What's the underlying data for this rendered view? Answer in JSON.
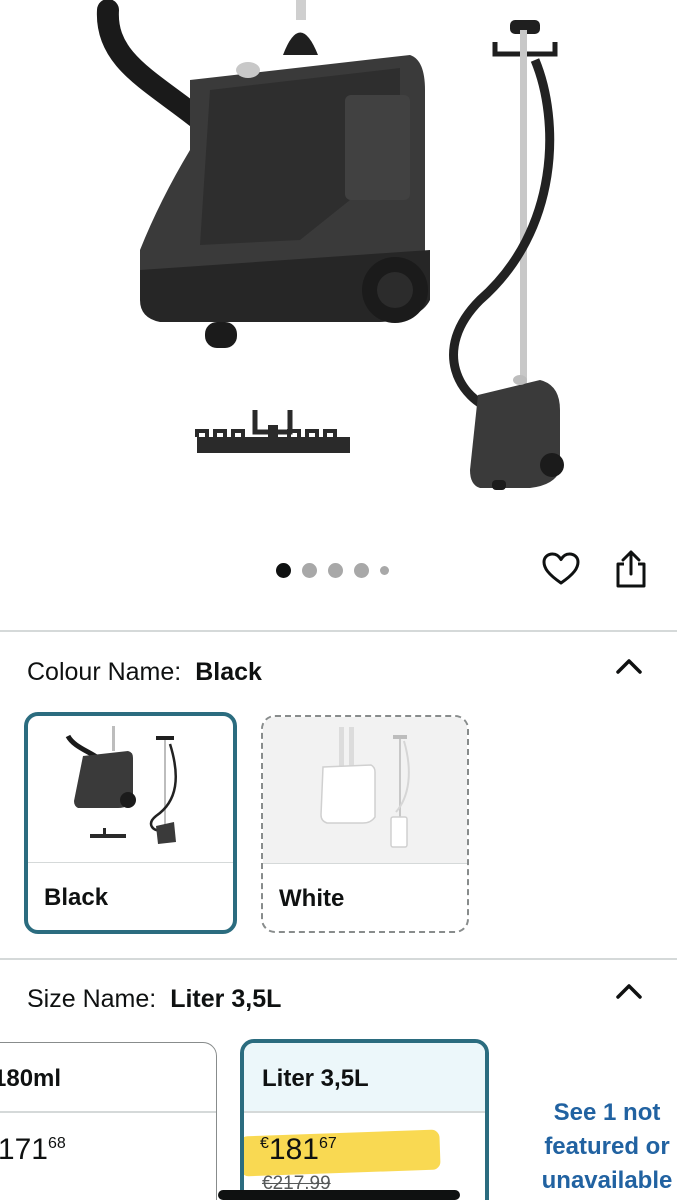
{
  "product": {
    "image_alt": "Black garment steamer with stand and hanger",
    "carousel": {
      "total": 5,
      "active_index": 0
    }
  },
  "actions": {
    "wishlist_icon": "heart-icon",
    "share_icon": "share-icon"
  },
  "colour": {
    "label": "Colour Name:",
    "selected": "Black",
    "expanded": true,
    "options": [
      {
        "name": "Black",
        "selected": true
      },
      {
        "name": "White",
        "selected": false
      }
    ]
  },
  "size": {
    "label": "Size Name:",
    "selected": "Liter 3,5L",
    "expanded": true,
    "options": [
      {
        "name": "180ml",
        "price_main": "171",
        "price_frac": "68",
        "currency": "€",
        "was": ""
      },
      {
        "name": "Liter 3,5L",
        "price_main": "181",
        "price_frac": "67",
        "currency": "€",
        "was": "€217.99"
      }
    ],
    "see_more": [
      "See 1 not",
      "featured or",
      "unavailable"
    ]
  },
  "colors": {
    "accent": "#2b6c7f",
    "link": "#2162a1",
    "highlight": "#f8d234"
  }
}
